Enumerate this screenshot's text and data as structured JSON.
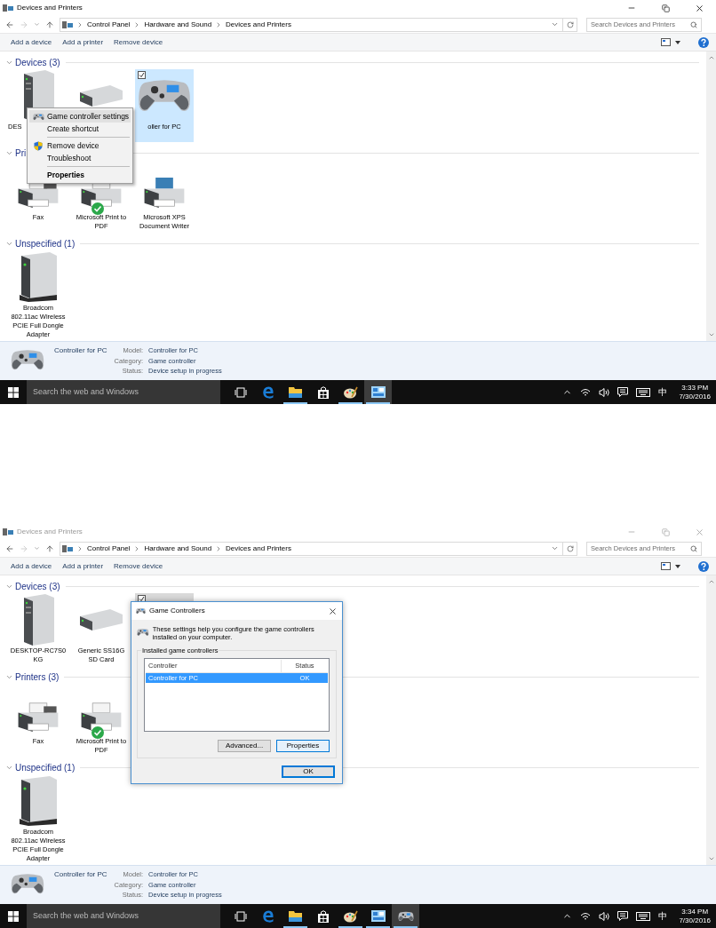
{
  "screens": [
    {
      "window": {
        "title": "Devices and Printers",
        "active": true
      },
      "breadcrumb": [
        "Control Panel",
        "Hardware and Sound",
        "Devices and Printers"
      ],
      "search": {
        "placeholder": "Search Devices and Printers"
      },
      "commands": [
        "Add a device",
        "Add a printer",
        "Remove device"
      ],
      "sections": [
        {
          "title": "Devices (3)",
          "expanded": true,
          "items": [
            {
              "kind": "tower",
              "label": "DES",
              "selected": false,
              "cut_at_end": true
            },
            {
              "kind": "drive",
              "selected": false
            },
            {
              "kind": "gamepad",
              "label": "oller for PC",
              "selected": true,
              "checked": true
            }
          ]
        },
        {
          "title": "Pri",
          "expanded": true,
          "items": [
            {
              "kind": "fax",
              "label": "Fax",
              "selected": false,
              "default": false
            },
            {
              "kind": "printer",
              "label": "Microsoft Print to PDF",
              "selected": false,
              "default": true
            },
            {
              "kind": "xps",
              "label": "Microsoft XPS Document Writer",
              "selected": false,
              "default": false
            }
          ]
        },
        {
          "title": "Unspecified (1)",
          "expanded": true,
          "items": [
            {
              "kind": "box",
              "label": "Broadcom 802.11ac Wireless PCIE Full Dongle Adapter",
              "selected": false
            }
          ]
        }
      ],
      "details": {
        "name": "Controller for PC",
        "fields": [
          {
            "label": "Model:",
            "value": "Controller for PC"
          },
          {
            "label": "Category:",
            "value": "Game controller"
          },
          {
            "label": "Status:",
            "value": "Device setup in progress"
          }
        ]
      },
      "context_menu": {
        "items": [
          {
            "kind": "gamepad",
            "label": "Game controller settings",
            "selected": true,
            "default": false
          },
          {
            "kind": "plain",
            "label": "Create shortcut",
            "selected": false,
            "default": false
          },
          {
            "kind": "separator"
          },
          {
            "kind": "shield",
            "label": "Remove device",
            "selected": false,
            "default": false
          },
          {
            "kind": "plain",
            "label": "Troubleshoot",
            "selected": false,
            "default": false
          },
          {
            "kind": "separator"
          },
          {
            "kind": "plain",
            "label": "Properties",
            "selected": false,
            "default": true
          }
        ]
      },
      "taskbar": {
        "search_placeholder": "Search the web and Windows",
        "apps": [
          {
            "kind": "taskview",
            "running": false,
            "active": false
          },
          {
            "kind": "edge",
            "running": false,
            "active": false
          },
          {
            "kind": "explorer",
            "running": true,
            "active": false
          },
          {
            "kind": "store",
            "running": false,
            "active": false
          },
          {
            "kind": "paint",
            "running": true,
            "active": false
          },
          {
            "kind": "control",
            "running": true,
            "active": true
          }
        ],
        "ime": "中",
        "time": "3:33 PM",
        "date": "7/30/2016"
      }
    },
    {
      "window": {
        "title": "Devices and Printers",
        "active": false
      },
      "breadcrumb": [
        "Control Panel",
        "Hardware and Sound",
        "Devices and Printers"
      ],
      "search": {
        "placeholder": "Search Devices and Printers"
      },
      "commands": [
        "Add a device",
        "Add a printer",
        "Remove device"
      ],
      "sections": [
        {
          "title": "Devices (3)",
          "expanded": true,
          "items": [
            {
              "kind": "tower",
              "label": "DESKTOP-RC7S0 KG",
              "selected": false
            },
            {
              "kind": "drive",
              "label": "Generic SS16G SD Card",
              "selected": false
            },
            {
              "selected": true,
              "checked": true
            }
          ]
        },
        {
          "title": "Printers (3)",
          "expanded": true,
          "items": [
            {
              "kind": "fax",
              "label": "Fax",
              "selected": false,
              "default": false
            },
            {
              "kind": "printer",
              "label": "Microsoft Print to PDF",
              "selected": false,
              "default": true
            }
          ]
        },
        {
          "title": "Unspecified (1)",
          "expanded": true,
          "items": [
            {
              "kind": "box",
              "label": "Broadcom 802.11ac Wireless PCIE Full Dongle Adapter",
              "selected": false
            }
          ]
        }
      ],
      "details": {
        "name": "Controller for PC",
        "fields": [
          {
            "label": "Model:",
            "value": "Controller for PC"
          },
          {
            "label": "Category:",
            "value": "Game controller"
          },
          {
            "label": "Status:",
            "value": "Device setup in progress"
          }
        ]
      },
      "dialog": {
        "title": "Game Controllers",
        "description": "These settings help you configure the game controllers installed on your computer.",
        "group": "Installed game controllers",
        "columns": [
          "Controller",
          "Status"
        ],
        "rows": [
          {
            "cells": [
              "Controller for PC",
              "OK"
            ],
            "selected": true
          }
        ],
        "buttons": [
          {
            "label": "Advanced...",
            "kind": "normal"
          },
          {
            "label": "Properties",
            "kind": "hover"
          }
        ],
        "ok": {
          "label": "OK",
          "kind": "default"
        }
      },
      "taskbar": {
        "search_placeholder": "Search the web and Windows",
        "apps": [
          {
            "kind": "taskview",
            "running": false,
            "active": false
          },
          {
            "kind": "edge",
            "running": false,
            "active": false
          },
          {
            "kind": "explorer",
            "running": true,
            "active": false
          },
          {
            "kind": "store",
            "running": false,
            "active": false
          },
          {
            "kind": "paint",
            "running": true,
            "active": false
          },
          {
            "kind": "control",
            "running": true,
            "active": false
          },
          {
            "kind": "gamepad",
            "running": true,
            "active": true
          }
        ],
        "ime": "中",
        "time": "3:34 PM",
        "date": "7/30/2016"
      }
    }
  ]
}
